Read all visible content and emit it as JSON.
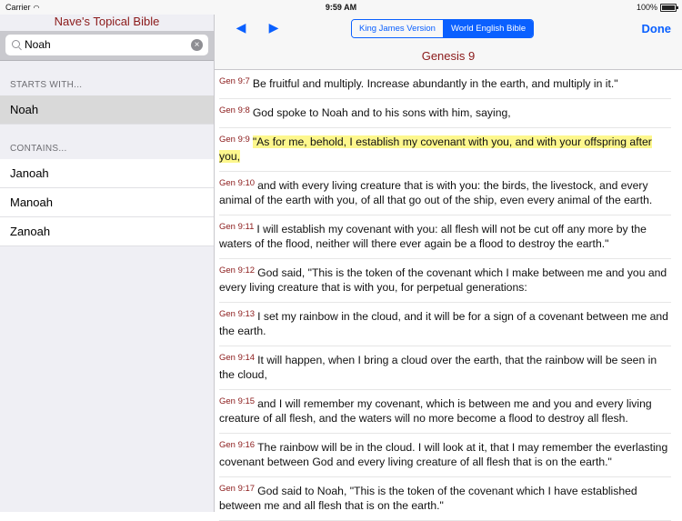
{
  "status": {
    "carrier": "Carrier",
    "time": "9:59 AM",
    "battery": "100%",
    "battery_level": 1.0
  },
  "sidebar": {
    "title": "Nave's Topical Bible",
    "search": {
      "value": "Noah",
      "placeholder": ""
    },
    "starts_header": "STARTS WITH...",
    "starts_items": [
      {
        "label": "Noah"
      }
    ],
    "contains_header": "CONTAINS...",
    "contains_items": [
      {
        "label": "Janoah"
      },
      {
        "label": "Manoah"
      },
      {
        "label": "Zanoah"
      }
    ]
  },
  "reader": {
    "versions": [
      {
        "label": "King James Version"
      },
      {
        "label": "World English Bible"
      }
    ],
    "done_label": "Done",
    "chapter_title": "Genesis 9",
    "verses": [
      {
        "ref": "Gen 9:7",
        "text": "Be fruitful and multiply. Increase abundantly in the earth, and multiply in it.\""
      },
      {
        "ref": "Gen 9:8",
        "text": "God spoke to Noah and to his sons with him, saying,"
      },
      {
        "ref": "Gen 9:9",
        "text": "\"As for me, behold, I establish my covenant with you, and with your offspring after you,"
      },
      {
        "ref": "Gen 9:10",
        "text": "and with every living creature that is with you: the birds, the livestock, and every animal of the earth with you, of all that go out of the ship, even every animal of the earth."
      },
      {
        "ref": "Gen 9:11",
        "text": "I will establish my covenant with you: all flesh will not be cut off any more by the waters of the flood, neither will there ever again be a flood to destroy the earth.\""
      },
      {
        "ref": "Gen 9:12",
        "text": "God said, \"This is the token of the covenant which I make between me and you and every living creature that is with you, for perpetual generations:"
      },
      {
        "ref": "Gen 9:13",
        "text": "I set my rainbow in the cloud, and it will be for a sign of a covenant between me and the earth."
      },
      {
        "ref": "Gen 9:14",
        "text": "It will happen, when I bring a cloud over the earth, that the rainbow will be seen in the cloud,"
      },
      {
        "ref": "Gen 9:15",
        "text": "and I will remember my covenant, which is between me and you and every living creature of all flesh, and the waters will no more become a flood to destroy all flesh."
      },
      {
        "ref": "Gen 9:16",
        "text": "The rainbow will be in the cloud. I will look at it, that I may remember the everlasting covenant between God and every living creature of all flesh that is on the earth.\""
      },
      {
        "ref": "Gen 9:17",
        "text": "God said to Noah, \"This is the token of the covenant which I have established between me and all flesh that is on the earth.\""
      }
    ]
  }
}
